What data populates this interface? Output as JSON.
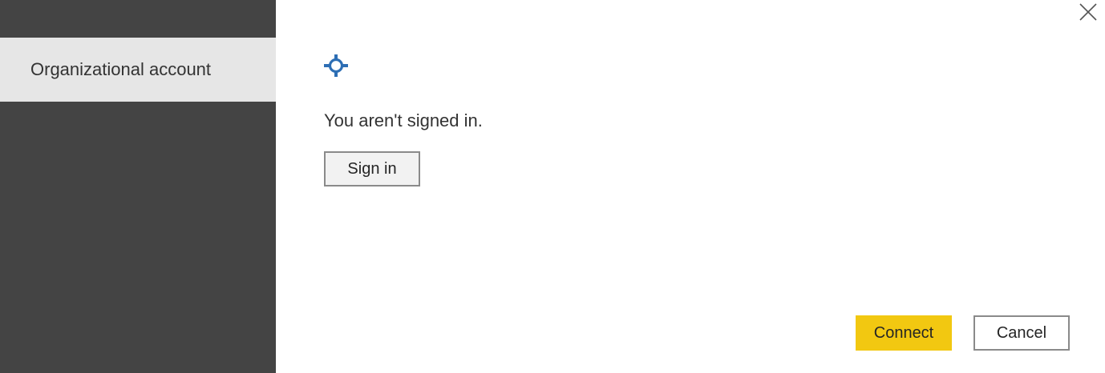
{
  "sidebar": {
    "items": [
      {
        "label": "Organizational account",
        "selected": true
      }
    ]
  },
  "main": {
    "status_text": "You aren't signed in.",
    "sign_in_label": "Sign in"
  },
  "footer": {
    "connect_label": "Connect",
    "cancel_label": "Cancel"
  },
  "icons": {
    "close": "close-icon",
    "connection": "connection-icon"
  },
  "colors": {
    "sidebar_bg": "#444444",
    "sidebar_selected_bg": "#e6e6e6",
    "accent": "#f2c811",
    "icon_blue": "#2d6eb4"
  }
}
